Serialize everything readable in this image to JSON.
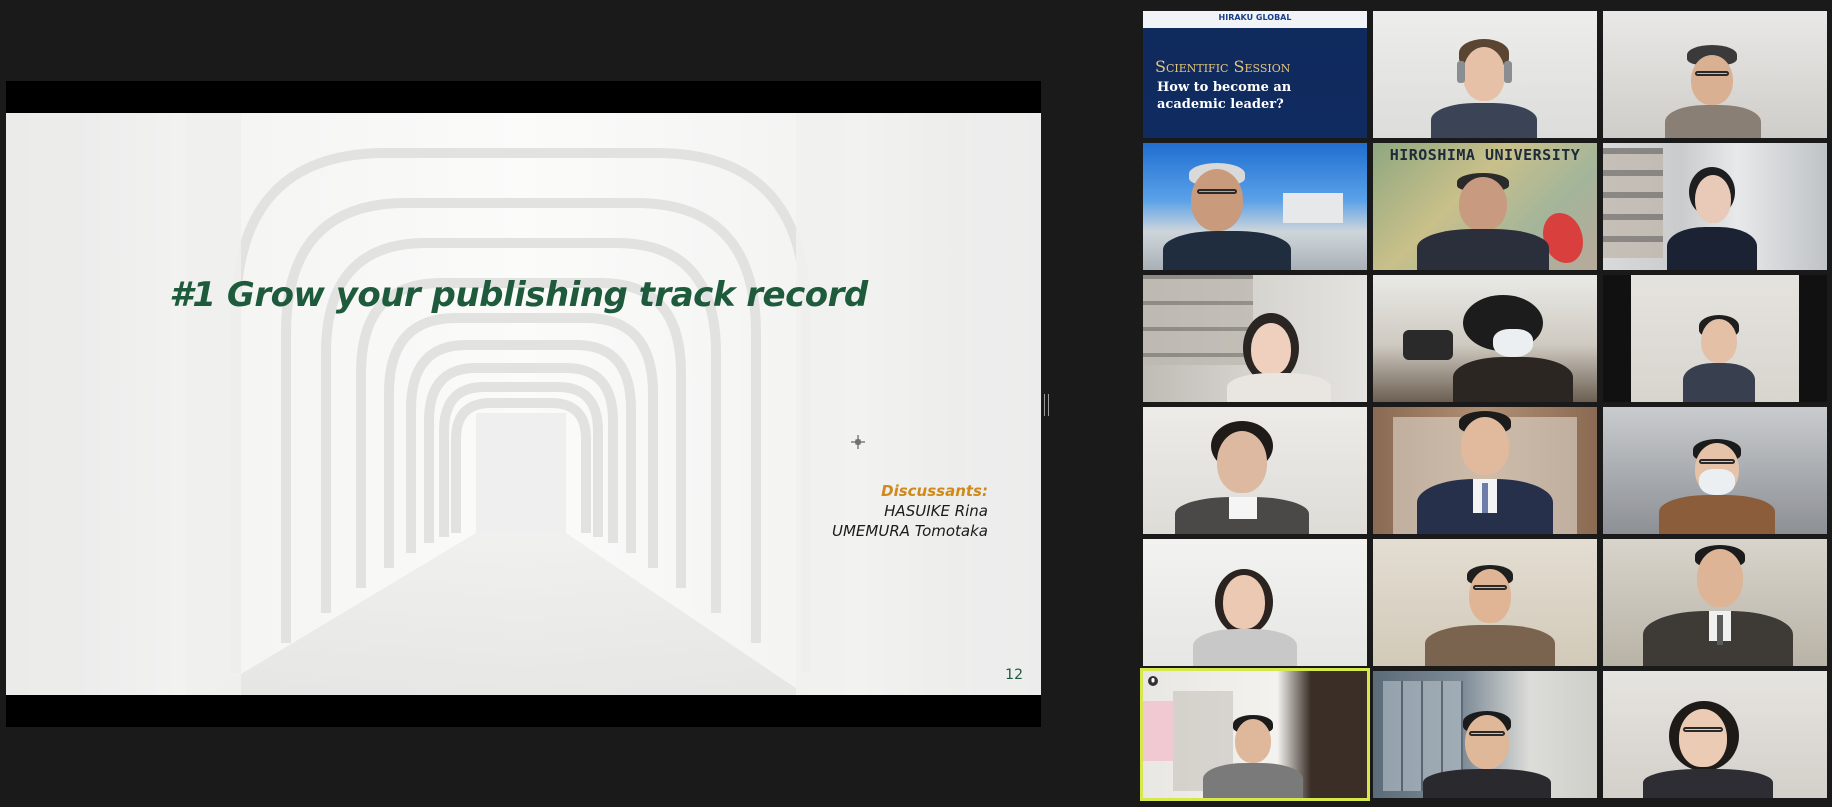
{
  "slide": {
    "title": "#1 Grow your publishing track record",
    "discussants_label": "Discussants:",
    "discussants": [
      "HASUIKE Rina",
      "UMEMURA Tomotaka"
    ],
    "page_number": "12",
    "title_color": "#1e5a3c",
    "label_color": "#d0891a"
  },
  "gallery": {
    "session_tile": {
      "logo": "HIRAKU GLOBAL",
      "title": "Scientific Session",
      "subtitle": "How to become an academic leader?"
    },
    "university_tile": {
      "banner": "HIROSHIMA UNIVERSITY"
    },
    "active_speaker_color": "#d7e84c"
  }
}
